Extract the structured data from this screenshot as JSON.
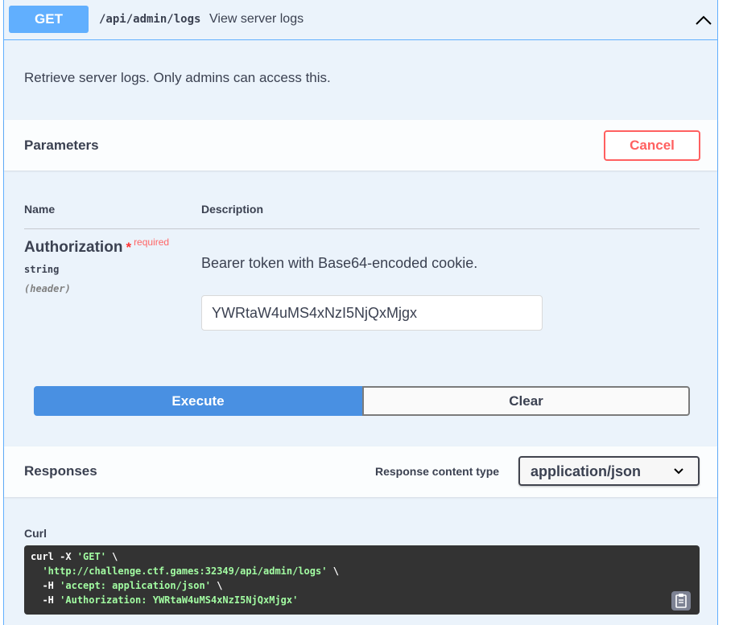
{
  "summary": {
    "method": "GET",
    "path": "/api/admin/logs",
    "description": "View server logs"
  },
  "description": "Retrieve server logs. Only admins can access this.",
  "parameters": {
    "title": "Parameters",
    "cancel_label": "Cancel",
    "col_name": "Name",
    "col_description": "Description",
    "param": {
      "name": "Authorization",
      "required_star": "*",
      "required_label": "required",
      "type": "string",
      "in": "(header)",
      "description": "Bearer token with Base64-encoded cookie.",
      "value": "YWRtaW4uMS4xNzI5NjQxMjgx"
    }
  },
  "actions": {
    "execute_label": "Execute",
    "clear_label": "Clear"
  },
  "responses": {
    "title": "Responses",
    "content_type_label": "Response content type",
    "content_type_value": "application/json"
  },
  "curl": {
    "label": "Curl",
    "line1_cmd": "curl -X ",
    "line1_str": "'GET'",
    "line1_end": " \\",
    "line2_str": "'http://challenge.ctf.games:32349/api/admin/logs'",
    "line2_end": " \\",
    "line3_cmd": "-H ",
    "line3_str": "'accept: application/json'",
    "line3_end": " \\",
    "line4_cmd": "-H ",
    "line4_str": "'Authorization: YWRtaW4uMS4xNzI5NjQxMjgx'"
  },
  "colors": {
    "get_accent": "#61affe",
    "execute": "#4990e2",
    "cancel": "#ff6060",
    "curl_bg": "#333333",
    "curl_string": "#a2fca2"
  }
}
